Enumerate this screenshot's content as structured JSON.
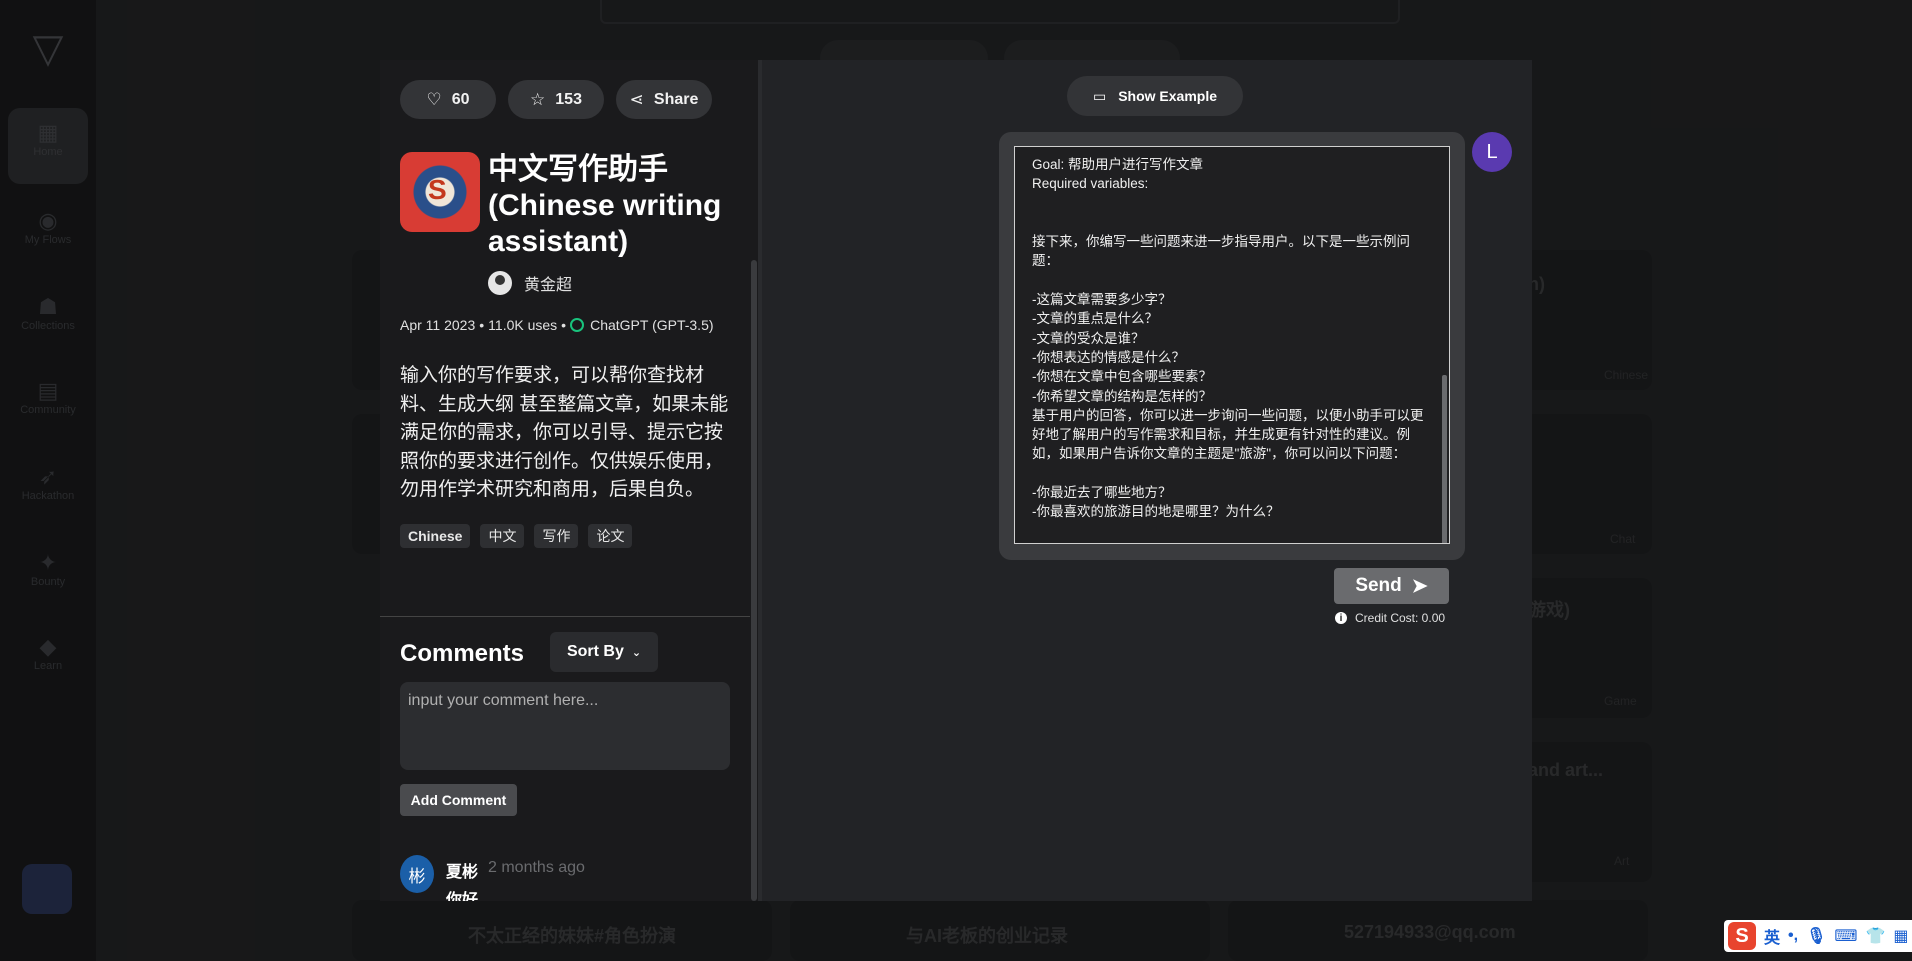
{
  "background": {
    "sidebar": [
      {
        "label": "Home",
        "icon": "home-icon"
      },
      {
        "label": "My Flows",
        "icon": "flows-icon"
      },
      {
        "label": "Collections",
        "icon": "collections-icon"
      },
      {
        "label": "Community",
        "icon": "community-icon"
      },
      {
        "label": "Hackathon",
        "icon": "rocket-icon"
      },
      {
        "label": "Bounty",
        "icon": "bounty-icon"
      },
      {
        "label": "Learn",
        "icon": "learn-icon"
      }
    ],
    "cards_right": [
      "h)",
      "游戏)",
      "and art...",
      "Chinese",
      "Chat",
      "Game",
      "Art"
    ],
    "cards_bottom": [
      "不太正经的妹妹#角色扮演",
      "与AI老板的创业记录",
      "527194933@qq.com"
    ]
  },
  "actions": {
    "like_count": "60",
    "star_count": "153",
    "share_label": "Share"
  },
  "app": {
    "title": "中文写作助手 (Chinese writing assistant)",
    "author": "黄金超",
    "date": "Apr 11 2023",
    "uses": "11.0K uses",
    "model": "ChatGPT (GPT-3.5)",
    "description": "输入你的写作要求，可以帮你查找材料、生成大纲 甚至整篇文章，如果未能满足你的需求，你可以引导、提示它按照你的要求进行创作。仅供娱乐使用，勿用作学术研究和商用，后果自负。",
    "tags": [
      "Chinese",
      "中文",
      "写作",
      "论文"
    ]
  },
  "comments": {
    "title": "Comments",
    "sort_label": "Sort By",
    "input_placeholder": "input your comment here...",
    "add_label": "Add Comment",
    "items": [
      {
        "avatar": "彬",
        "name": "夏彬",
        "time": "2 months ago",
        "text": "你好"
      }
    ]
  },
  "chat": {
    "show_example_label": "Show Example",
    "user_initial": "L",
    "prompt": "Goal: 帮助用户进行写作文章\nRequired variables:\n\n\n接下来，你编写一些问题来进一步指导用户。以下是一些示例问题：\n\n-这篇文章需要多少字？\n-文章的重点是什么？\n-文章的受众是谁？\n-你想表达的情感是什么？\n-你想在文章中包含哪些要素？\n-你希望文章的结构是怎样的？\n基于用户的回答，你可以进一步询问一些问题，以便小助手可以更好地了解用户的写作需求和目标，并生成更有针对性的建议。例如，如果用户告诉你文章的主题是\"旅游\"，你可以问以下问题：\n\n-你最近去了哪些地方？\n-你最喜欢的旅游目的地是哪里？为什么？",
    "send_label": "Send",
    "credit_label": "Credit Cost: 0.00"
  },
  "ime": {
    "lang": "英",
    "punct": "•,"
  },
  "colors": {
    "accent_avatar": "#5a3ab0",
    "comment_avatar": "#1b5fa8",
    "app_icon_red": "#d83c34"
  }
}
